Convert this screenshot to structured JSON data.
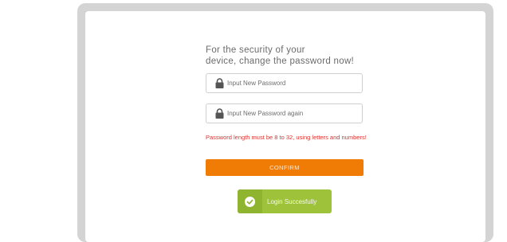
{
  "dialog": {
    "heading_line1": "For the security of your",
    "heading_line2": "device, change the password now!"
  },
  "form": {
    "new_password": {
      "placeholder": "Input New Password",
      "value": "",
      "icon": "lock-icon"
    },
    "confirm_password": {
      "placeholder": "Input New Password again",
      "value": "",
      "icon": "lock-icon"
    },
    "error_message": "Password length must be 8 to 32, using letters and numbers!",
    "confirm_label": "CONFIRM"
  },
  "toast": {
    "message": "Login Succesfully",
    "icon": "check-circle-icon"
  },
  "colors": {
    "accent": "#f07c06",
    "error": "#d9322e",
    "success": "#9ec33b"
  }
}
